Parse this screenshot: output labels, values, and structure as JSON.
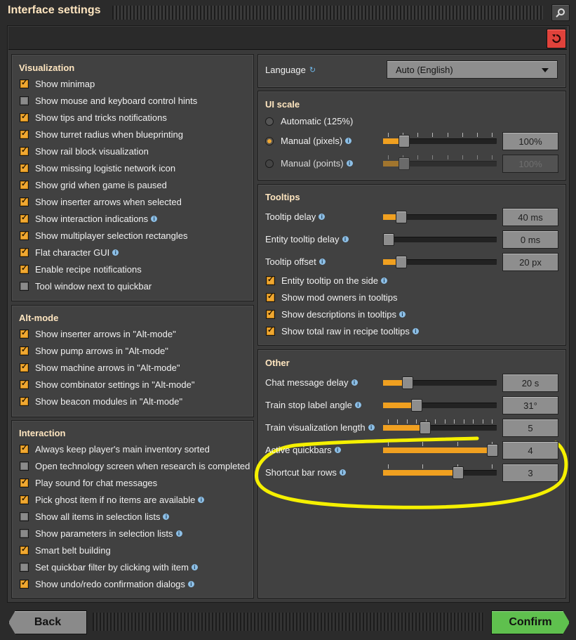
{
  "window": {
    "title": "Interface settings"
  },
  "visualization": {
    "title": "Visualization",
    "items": [
      {
        "label": "Show minimap",
        "checked": true,
        "info": false
      },
      {
        "label": "Show mouse and keyboard control hints",
        "checked": false,
        "info": false
      },
      {
        "label": "Show tips and tricks notifications",
        "checked": true,
        "info": false
      },
      {
        "label": "Show turret radius when blueprinting",
        "checked": true,
        "info": false
      },
      {
        "label": "Show rail block visualization",
        "checked": true,
        "info": false
      },
      {
        "label": "Show missing logistic network icon",
        "checked": true,
        "info": false
      },
      {
        "label": "Show grid when game is paused",
        "checked": true,
        "info": false
      },
      {
        "label": "Show inserter arrows when selected",
        "checked": true,
        "info": false
      },
      {
        "label": "Show interaction indications",
        "checked": true,
        "info": true
      },
      {
        "label": "Show multiplayer selection rectangles",
        "checked": true,
        "info": false
      },
      {
        "label": "Flat character GUI",
        "checked": true,
        "info": true
      },
      {
        "label": "Enable recipe notifications",
        "checked": true,
        "info": false
      },
      {
        "label": "Tool window next to quickbar",
        "checked": false,
        "info": false
      }
    ]
  },
  "altmode": {
    "title": "Alt-mode",
    "items": [
      {
        "label": "Show inserter arrows in \"Alt-mode\"",
        "checked": true
      },
      {
        "label": "Show pump arrows in \"Alt-mode\"",
        "checked": true
      },
      {
        "label": "Show machine arrows in \"Alt-mode\"",
        "checked": true
      },
      {
        "label": "Show combinator settings in \"Alt-mode\"",
        "checked": true
      },
      {
        "label": "Show beacon modules in \"Alt-mode\"",
        "checked": true
      }
    ]
  },
  "interaction": {
    "title": "Interaction",
    "items": [
      {
        "label": "Always keep player's main inventory sorted",
        "checked": true,
        "info": false
      },
      {
        "label": "Open technology screen when research is completed",
        "checked": false,
        "info": false
      },
      {
        "label": "Play sound for chat messages",
        "checked": true,
        "info": false
      },
      {
        "label": "Pick ghost item if no items are available",
        "checked": true,
        "info": true
      },
      {
        "label": "Show all items in selection lists",
        "checked": false,
        "info": true
      },
      {
        "label": "Show parameters in selection lists",
        "checked": false,
        "info": true
      },
      {
        "label": "Smart belt building",
        "checked": true,
        "info": false
      },
      {
        "label": "Set quickbar filter by clicking with item",
        "checked": false,
        "info": true
      },
      {
        "label": "Show undo/redo confirmation dialogs",
        "checked": true,
        "info": true
      }
    ]
  },
  "language": {
    "label": "Language",
    "value": "Auto (English)"
  },
  "uiscale": {
    "title": "UI scale",
    "automatic": "Automatic (125%)",
    "manual_pixels": {
      "label": "Manual (pixels)",
      "value": "100%",
      "level": 0.15
    },
    "manual_points": {
      "label": "Manual (points)",
      "value": "100%",
      "level": 0.15
    }
  },
  "tooltips": {
    "title": "Tooltips",
    "sliders": [
      {
        "label": "Tooltip delay",
        "value": "40 ms",
        "level": 0.12
      },
      {
        "label": "Entity tooltip delay",
        "value": "0 ms",
        "level": 0.0
      },
      {
        "label": "Tooltip offset",
        "value": "20 px",
        "level": 0.12
      }
    ],
    "checks": [
      {
        "label": "Entity tooltip on the side",
        "checked": true,
        "info": true
      },
      {
        "label": "Show mod owners in tooltips",
        "checked": true,
        "info": false
      },
      {
        "label": "Show descriptions in tooltips",
        "checked": true,
        "info": true
      },
      {
        "label": "Show total raw in recipe tooltips",
        "checked": true,
        "info": true
      }
    ]
  },
  "other": {
    "title": "Other",
    "sliders": [
      {
        "label": "Chat message delay",
        "value": "20 s",
        "level": 0.18,
        "ticks": false
      },
      {
        "label": "Train stop label angle",
        "value": "31°",
        "level": 0.27,
        "ticks": false
      },
      {
        "label": "Train visualization length",
        "value": "5",
        "level": 0.35,
        "ticks": true
      },
      {
        "label": "Active quickbars",
        "value": "4",
        "level": 1.0,
        "ticks": true
      },
      {
        "label": "Shortcut bar rows",
        "value": "3",
        "level": 0.67,
        "ticks": true
      }
    ]
  },
  "footer": {
    "back": "Back",
    "confirm": "Confirm"
  },
  "colors": {
    "accent": "#f0a832",
    "highlight": "#f5f000",
    "confirm": "#5fc04e",
    "reset": "#e0423b"
  },
  "icons": {
    "search": "search-icon",
    "reset": "reset-icon",
    "info": "info-icon",
    "dropdown": "chevron-down-icon"
  }
}
